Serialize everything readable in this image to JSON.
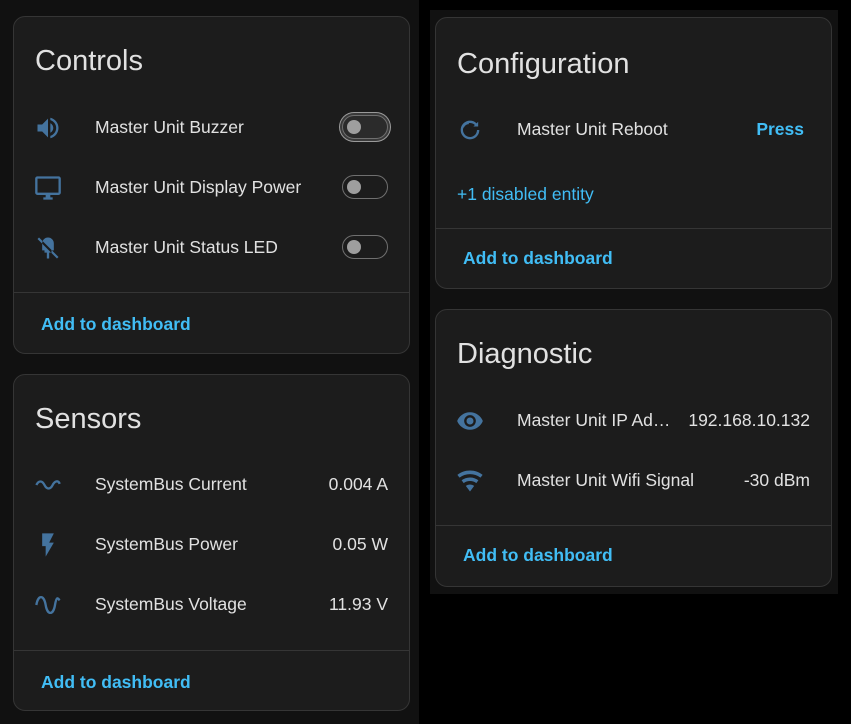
{
  "controls": {
    "title": "Controls",
    "rows": [
      {
        "label": "Master Unit Buzzer",
        "icon": "volume-icon"
      },
      {
        "label": "Master Unit Display Power",
        "icon": "monitor-icon"
      },
      {
        "label": "Master Unit Status LED",
        "icon": "led-off-icon"
      }
    ],
    "footer": "Add to dashboard"
  },
  "sensors": {
    "title": "Sensors",
    "rows": [
      {
        "label": "SystemBus Current",
        "value": "0.004 A",
        "icon": "current-ac-icon"
      },
      {
        "label": "SystemBus Power",
        "value": "0.05 W",
        "icon": "flash-icon"
      },
      {
        "label": "SystemBus Voltage",
        "value": "11.93 V",
        "icon": "sine-wave-icon"
      }
    ],
    "footer": "Add to dashboard"
  },
  "configuration": {
    "title": "Configuration",
    "rows": [
      {
        "label": "Master Unit Reboot",
        "action": "Press",
        "icon": "restart-icon"
      }
    ],
    "disabled_link": "+1 disabled entity",
    "footer": "Add to dashboard"
  },
  "diagnostic": {
    "title": "Diagnostic",
    "rows": [
      {
        "label": "Master Unit IP Address",
        "value": "192.168.10.132",
        "icon": "eye-icon"
      },
      {
        "label": "Master Unit Wifi Signal",
        "value": "-30 dBm",
        "icon": "wifi-icon"
      }
    ],
    "footer": "Add to dashboard"
  },
  "colors": {
    "accent": "#41bdf5",
    "icon": "#44739e",
    "card": "#1c1c1c",
    "background": "#111111"
  }
}
